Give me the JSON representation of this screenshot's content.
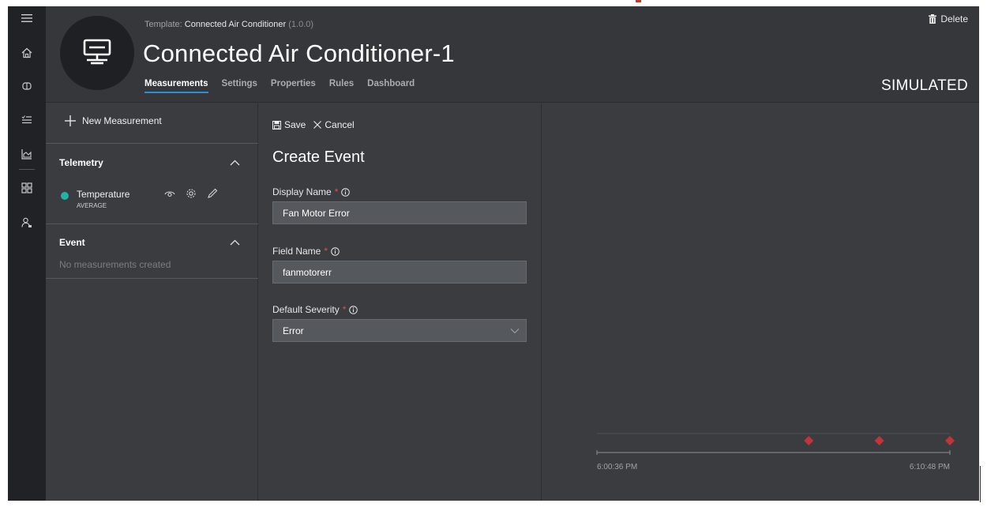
{
  "rail": {
    "icons": [
      "hamburger-icon",
      "home-icon",
      "device-icon",
      "rules-icon",
      "analytics-icon",
      "dashboard-icon",
      "admin-icon"
    ]
  },
  "header": {
    "template_prefix": "Template:",
    "template_name": "Connected Air Conditioner",
    "template_version": "(1.0.0)",
    "device_title": "Connected Air Conditioner-1",
    "delete_label": "Delete",
    "status_label": "SIMULATED",
    "tabs": [
      {
        "label": "Measurements",
        "active": true
      },
      {
        "label": "Settings",
        "active": false
      },
      {
        "label": "Properties",
        "active": false
      },
      {
        "label": "Rules",
        "active": false
      },
      {
        "label": "Dashboard",
        "active": false
      }
    ]
  },
  "measurements_panel": {
    "new_measurement_label": "New Measurement",
    "telemetry_section": {
      "title": "Telemetry",
      "items": [
        {
          "name": "Temperature",
          "aggregation": "AVERAGE",
          "color": "#21b4a4"
        }
      ]
    },
    "event_section": {
      "title": "Event",
      "empty_text": "No measurements created"
    }
  },
  "editor": {
    "save_label": "Save",
    "cancel_label": "Cancel",
    "title": "Create Event",
    "display_name": {
      "label": "Display Name",
      "required": "*",
      "value": "Fan Motor Error"
    },
    "field_name": {
      "label": "Field Name",
      "required": "*",
      "value": "fanmotorerr"
    },
    "default_severity": {
      "label": "Default Severity",
      "required": "*",
      "value": "Error"
    }
  },
  "chart_data": {
    "type": "scatter",
    "x_start_label": "6:00:36 PM",
    "x_end_label": "6:10:48 PM",
    "marker_color": "#c0343c",
    "events": [
      {
        "x_fraction": 0.6
      },
      {
        "x_fraction": 0.8
      },
      {
        "x_fraction": 1.0
      }
    ]
  }
}
